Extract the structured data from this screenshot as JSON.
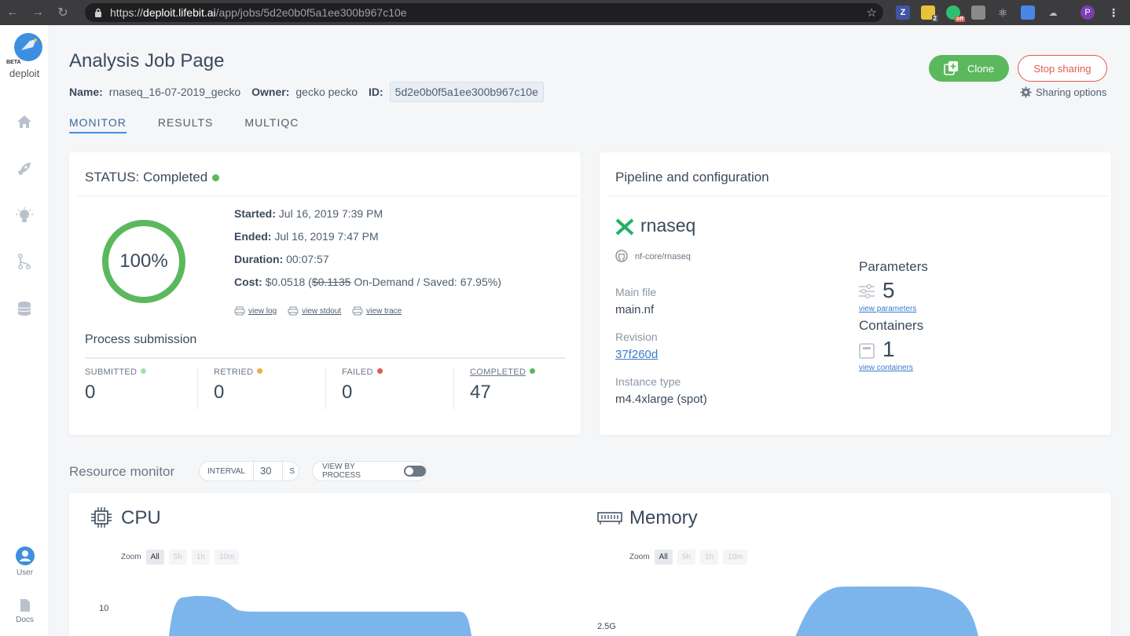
{
  "browser": {
    "url_scheme": "https://",
    "url_host": "deploit.lifebit.ai",
    "url_path": "/app/jobs/5d2e0b0f5a1ee300b967c10e",
    "ext_badge_count": "2",
    "ext_off_label": "off",
    "profile_initial": "P"
  },
  "sidebar": {
    "beta_label": "BETA",
    "logo_word": "deploit",
    "user_label": "User",
    "docs_label": "Docs"
  },
  "header": {
    "title": "Analysis Job Page",
    "name_label": "Name:",
    "name_value": "rnaseq_16-07-2019_gecko",
    "owner_label": "Owner:",
    "owner_value": "gecko pecko",
    "id_label": "ID:",
    "id_value": "5d2e0b0f5a1ee300b967c10e",
    "clone_label": "Clone",
    "stop_sharing_label": "Stop sharing",
    "sharing_options_label": "Sharing options"
  },
  "tabs": [
    {
      "label": "MONITOR",
      "active": true
    },
    {
      "label": "RESULTS",
      "active": false
    },
    {
      "label": "MULTIQC",
      "active": false
    }
  ],
  "status": {
    "title": "STATUS: Completed",
    "progress_pct": 100,
    "progress_label": "100%",
    "started_label": "Started:",
    "started_value": "Jul 16, 2019 7:39 PM",
    "ended_label": "Ended:",
    "ended_value": "Jul 16, 2019 7:47 PM",
    "duration_label": "Duration:",
    "duration_value": "00:07:57",
    "cost_label": "Cost:",
    "cost_value": "$0.0518",
    "cost_ondemand": "$0.1135",
    "cost_suffix": "On-Demand / Saved: 67.95%)",
    "links": [
      "view log",
      "view stdout",
      "view trace"
    ]
  },
  "process_submission": {
    "title": "Process submission",
    "columns": [
      {
        "label": "SUBMITTED",
        "value": "0",
        "color": "#a8e0a8"
      },
      {
        "label": "RETRIED",
        "value": "0",
        "color": "#f0ad4e"
      },
      {
        "label": "FAILED",
        "value": "0",
        "color": "#e05a4f"
      },
      {
        "label": "COMPLETED",
        "value": "47",
        "color": "#5cb85c"
      }
    ]
  },
  "pipeline": {
    "title": "Pipeline and configuration",
    "name": "rnaseq",
    "repo": "nf-core/rnaseq",
    "main_file_label": "Main file",
    "main_file_value": "main.nf",
    "revision_label": "Revision",
    "revision_value": "37f260d",
    "instance_label": "Instance type",
    "instance_value": "m4.4xlarge (spot)",
    "parameters_label": "Parameters",
    "parameters_count": "5",
    "parameters_link": "view parameters",
    "containers_label": "Containers",
    "containers_count": "1",
    "containers_link": "view containers"
  },
  "resource_monitor": {
    "title": "Resource monitor",
    "interval_label": "INTERVAL",
    "interval_value": "30",
    "interval_unit": "S",
    "view_by_process_label": "VIEW BY PROCESS",
    "zoom_label": "Zoom",
    "zoom_options": [
      "All",
      "5h",
      "1h",
      "10m"
    ],
    "cpu_title": "CPU",
    "cpu_axis_tick": "10",
    "memory_title": "Memory",
    "memory_axis_tick": "2.5G",
    "series_color": "#7cb5ec"
  }
}
